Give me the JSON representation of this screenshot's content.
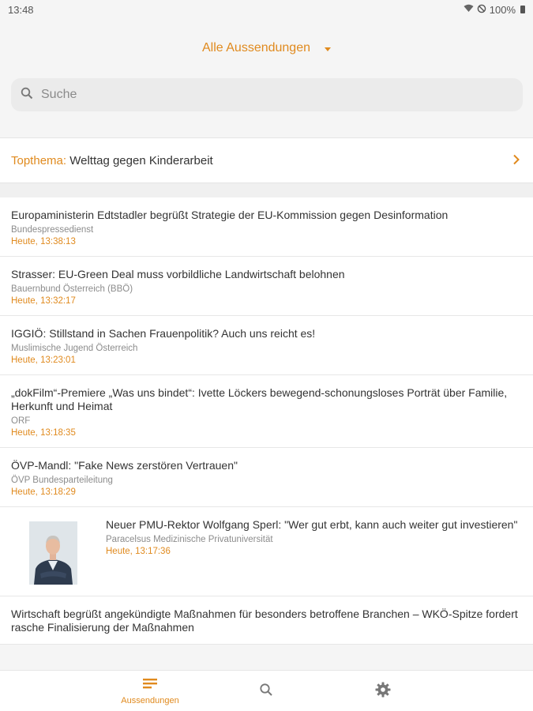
{
  "status_bar": {
    "time": "13:48",
    "battery": "100%"
  },
  "header": {
    "feed_selector": "Alle Aussendungen",
    "search_placeholder": "Suche"
  },
  "topthema": {
    "label": "Topthema:",
    "text": "Welttag gegen Kinderarbeit"
  },
  "news": [
    {
      "title": "Europaministerin Edtstadler begrüßt Strategie der EU-Kommission gegen Desinformation",
      "source": "Bundespressedienst",
      "time": "Heute, 13:38:13"
    },
    {
      "title": "Strasser: EU-Green Deal muss vorbildliche Landwirtschaft belohnen",
      "source": "Bauernbund Österreich (BBÖ)",
      "time": "Heute, 13:32:17"
    },
    {
      "title": "IGGIÖ: Stillstand in Sachen Frauenpolitik? Auch uns reicht es!",
      "source": "Muslimische Jugend Österreich",
      "time": "Heute, 13:23:01"
    },
    {
      "title": "„dokFilm“-Premiere „Was uns bindet“: Ivette Löckers bewegend-schonungsloses Porträt über Familie, Herkunft und Heimat",
      "source": "ORF",
      "time": "Heute, 13:18:35"
    },
    {
      "title": "ÖVP-Mandl: \"Fake News zerstören Vertrauen\"",
      "source": "ÖVP Bundesparteileitung",
      "time": "Heute, 13:18:29"
    },
    {
      "title": "Neuer PMU-Rektor Wolfgang Sperl: \"Wer gut erbt, kann auch weiter gut investieren\"",
      "source": "Paracelsus Medizinische Privatuniversität",
      "time": "Heute, 13:17:36"
    },
    {
      "title": "Wirtschaft begrüßt angekündigte Maßnahmen für besonders betroffene Branchen – WKÖ-Spitze fordert rasche Finalisierung der Maßnahmen",
      "source": "",
      "time": ""
    }
  ],
  "bottom_nav": {
    "aussendungen_label": "Aussendungen"
  },
  "colors": {
    "accent": "#e08a1e"
  },
  "icons": {
    "search": "search-icon",
    "list": "list-icon",
    "settings": "gear-icon"
  }
}
